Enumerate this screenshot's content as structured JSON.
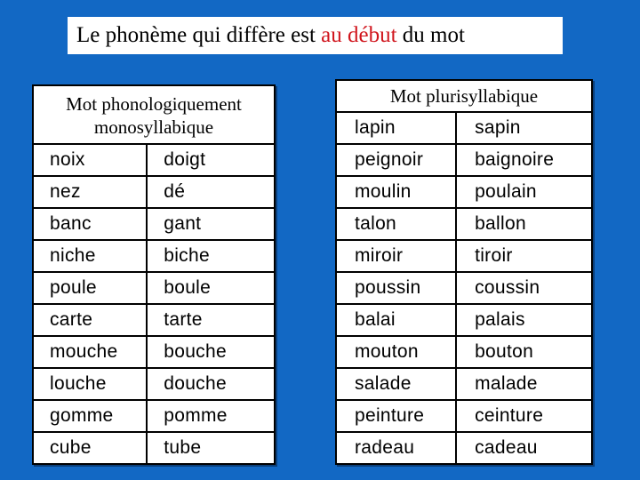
{
  "title": {
    "prefix": "Le phonème qui diffère est ",
    "highlight": "au début",
    "suffix": " du mot",
    "highlight_color": "#d0141c"
  },
  "colors": {
    "background": "#1268c4",
    "panel": "#ffffff",
    "text": "#000000"
  },
  "monosyllabic": {
    "header_line1": "Mot phonologiquement",
    "header_line2": "monosyllabique",
    "rows": [
      [
        "noix",
        "doigt"
      ],
      [
        "nez",
        "dé"
      ],
      [
        "banc",
        "gant"
      ],
      [
        "niche",
        "biche"
      ],
      [
        "poule",
        "boule"
      ],
      [
        "carte",
        "tarte"
      ],
      [
        "mouche",
        "bouche"
      ],
      [
        "louche",
        "douche"
      ],
      [
        "gomme",
        "pomme"
      ],
      [
        "cube",
        "tube"
      ]
    ]
  },
  "plurisyllabic": {
    "header": "Mot plurisyllabique",
    "rows": [
      [
        "lapin",
        "sapin"
      ],
      [
        "peignoir",
        "baignoire"
      ],
      [
        "moulin",
        "poulain"
      ],
      [
        "talon",
        "ballon"
      ],
      [
        "miroir",
        "tiroir"
      ],
      [
        "poussin",
        "coussin"
      ],
      [
        "balai",
        "palais"
      ],
      [
        "mouton",
        "bouton"
      ],
      [
        "salade",
        "malade"
      ],
      [
        "peinture",
        "ceinture"
      ],
      [
        "radeau",
        "cadeau"
      ]
    ]
  }
}
